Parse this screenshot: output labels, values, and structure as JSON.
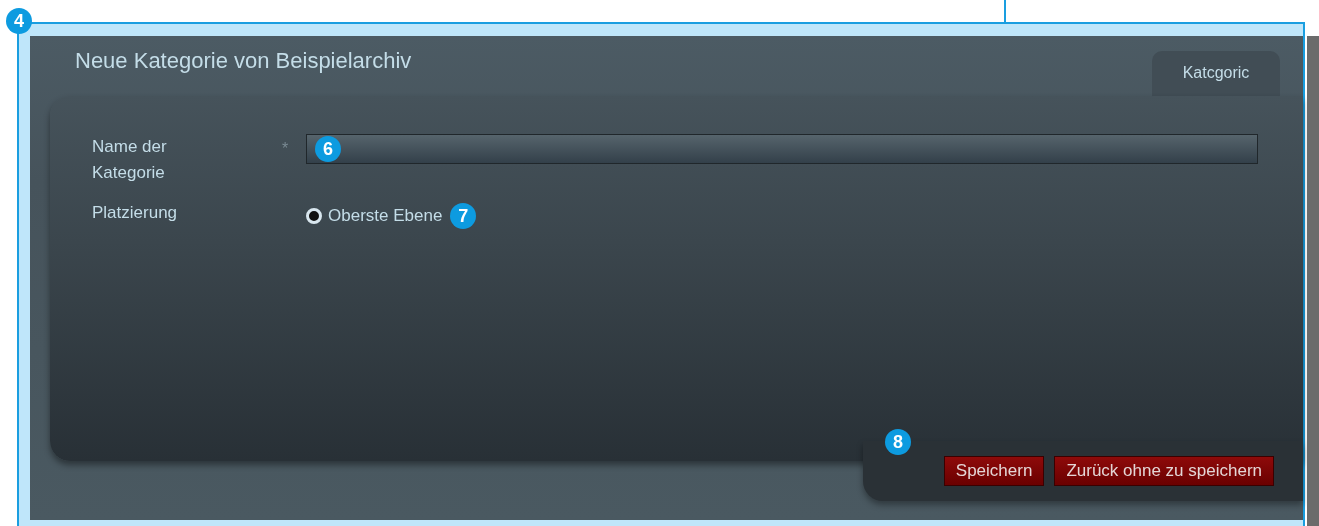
{
  "callouts": [
    {
      "label": "4"
    },
    {
      "label": "6"
    },
    {
      "label": "7"
    },
    {
      "label": "8"
    }
  ],
  "dialog": {
    "title": "Neue Kategorie von Beispielarchiv",
    "tabs": [
      {
        "label": "Katcgoric",
        "selected": true
      }
    ],
    "fields": [
      {
        "kind": "text",
        "label": "Name der Kategorie",
        "required_mark": "*"
      },
      {
        "kind": "radio",
        "label": "Platzierung",
        "options": [
          {
            "label": "Oberste Ebene",
            "selected": true
          }
        ]
      }
    ],
    "buttons": [
      "Speichern",
      "Zurück ohne zu speichern"
    ]
  }
}
